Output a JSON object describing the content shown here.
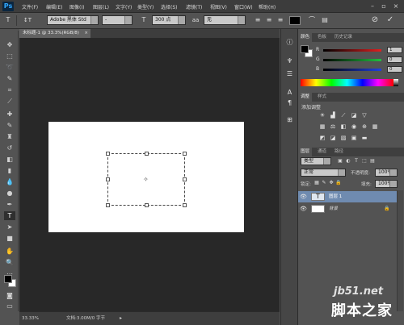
{
  "app": {
    "logo": "Ps"
  },
  "menubar": {
    "items": [
      "文件(F)",
      "编辑(E)",
      "图像(I)",
      "图层(L)",
      "文字(Y)",
      "类型(Y)",
      "选择(S)",
      "滤镜(T)",
      "视图(V)",
      "窗口(W)",
      "帮助(H)"
    ]
  },
  "options": {
    "tool_icon": "T",
    "orient_icon": "↕T",
    "font_family": "Adobe 黑体 Std",
    "font_style": "-",
    "size_icon": "T",
    "font_size": "300 点",
    "aa_icon": "aa",
    "antialias": "无",
    "confirm": "✓",
    "cancel": "⊘"
  },
  "document": {
    "tab_title": "未标题-1 @ 33.3%(RGB/8)",
    "tab_close": "×",
    "zoom": "33.33%",
    "doc_info": "文档:3.00M/0 字节"
  },
  "panels": {
    "color": {
      "tabs": [
        "颜色",
        "色板",
        "历史记录"
      ],
      "r_label": "R",
      "r_value": "1",
      "g_label": "G",
      "g_value": "0",
      "b_label": "B",
      "b_value": "0",
      "colors": {
        "r_track": "#e02020",
        "g_track": "#20c040",
        "b_track": "#2040e0"
      }
    },
    "adjustments": {
      "tabs": [
        "调整",
        "样式"
      ],
      "title": "添加调整"
    },
    "layers": {
      "tabs": [
        "图层",
        "通道",
        "路径"
      ],
      "kind": "类型",
      "blend_mode": "正常",
      "opacity_label": "不透明度:",
      "opacity": "100%",
      "lock_label": "锁定:",
      "fill_label": "填充:",
      "fill": "100%",
      "rows": [
        {
          "name": "图层 1",
          "thumb": "T"
        },
        {
          "name": "背景"
        }
      ]
    }
  },
  "watermark": {
    "line1": "jb51.net",
    "line2": "脚本之家"
  }
}
